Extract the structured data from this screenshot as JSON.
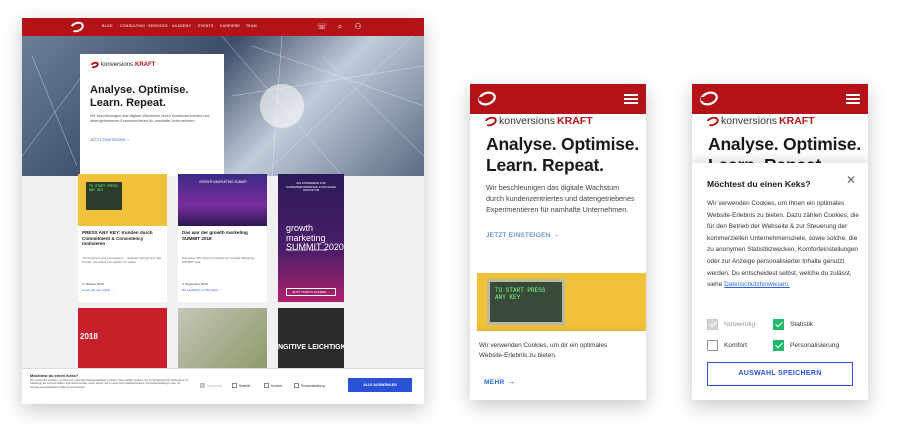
{
  "desktop": {
    "nav": {
      "items": [
        "BLOG",
        "CONSULTING",
        "SERVICES",
        "ACADEMY",
        "EVENTS",
        "KARRIERE",
        "TEAM",
        "ÜBER UNS"
      ]
    },
    "logo": {
      "prefix": "konversions",
      "suffix": "KRAFT"
    },
    "hero": {
      "title": "Analyse. Optimise. Learn. Repeat.",
      "subtitle": "Wir beschleunigen das digitale Wachstum durch kundenzentriertes und datengetriebenes Experimentieren für namhafte Unternehmen.",
      "cta": "JETZT EINSTEIGEN →"
    },
    "cards": [
      {
        "img_text": "TO START PRESS ANY KEY",
        "title": "PRESS ANY KEY: Kunden durch Commitment & Consistency motivieren",
        "excerpt": "\"Commitment und Consistency\" – dahinter verbirgt sich das Prinzip, uns selbst treu bleiben zu wollen.",
        "date": "4. Oktober 2018",
        "link": "Lesen Sie den Artikel →"
      },
      {
        "img_text": "GROWTH MARKETING SUMMIT",
        "title": "Das war der growth marketing SUMMIT 2018",
        "excerpt": "Wie jedes Jahr fand in Frankfurt der Growth Marketing SUMMIT statt.",
        "date": "4. September 2018",
        "link": "Die Highlights im Überblick →"
      }
    ],
    "summit": {
      "top": "DIE KONFERENZ FÜR KUNDENZENTRIERUNG & DIGITALES WACHSTUM",
      "title": "growth marketing SUMMIT 2020",
      "meta": "September 2020 · Frankfurt/Main",
      "btn": "JETZT TICKETS SICHERN →"
    },
    "row2": {
      "year": "2018",
      "banner": "NGITIVE LEICHTIGKE"
    },
    "cookie": {
      "heading": "Möchtest du einen Keks?",
      "text": "Wir verwenden Cookies, um Ihnen ein optimales Website-Erlebnis zu bieten. Dazu zählen Cookies, die für den Betrieb der Webseite & zur Steuerung der kommerziellen Unternehmensziele, sowie solche, die zu anonymen Statistikzwecken, Komforteinstellungen oder zur Anzeige personalisierter Inhalte genutzt werden.",
      "options": [
        "Notwendig",
        "Statistik",
        "Komfort",
        "Personalisierung"
      ],
      "button": "ALLE AUSWÄHLEN"
    }
  },
  "mobile1": {
    "logo": {
      "prefix": "konversions",
      "suffix": "KRAFT"
    },
    "title": "Analyse. Optimise. Learn. Repeat.",
    "text": "Wir beschleunigen das digitale Wachstum durch kundenzentriertes und datengetriebenes Experimentieren für namhafte Unternehmen.",
    "cta": "JETZT EINSTEIGEN",
    "img_text": "TO START PRESS ANY KEY",
    "cookie_text": "Wir verwenden Cookies, um dir ein optimales Website-Erlebnis zu bieten.",
    "more": "MEHR"
  },
  "mobile2": {
    "logo": {
      "prefix": "konversions",
      "suffix": "KRAFT"
    },
    "title": "Analyse. Optimise.",
    "title2": "Learn. Repeat.",
    "modal_title": "Möchtest du einen Keks?",
    "modal_text": "Wir verwenden Cookies, um Ihnen ein optimales Website-Erlebnis zu bieten. Dazu zählen Cookies, die für den Betrieb der Webseite & zur Steuerung der kommerziellen Unternehmensziele, sowie solche, die zu anonymen Statistikzwecken, Komforteinstellungen oder zur Anzeige personalisierter Inhalte genutzt werden. Du entscheidest selbst, welche du zulässt, siehe",
    "modal_link": "Datenschutzhinweisen.",
    "options": [
      {
        "label": "Notwendig",
        "state": "disabled"
      },
      {
        "label": "Statistik",
        "state": "checked"
      },
      {
        "label": "Komfort",
        "state": "unchecked"
      },
      {
        "label": "Personalisierung",
        "state": "checked"
      }
    ],
    "save": "AUSWAHL SPEICHERN"
  },
  "colors": {
    "brand": "#b31317",
    "link": "#2a6bd3",
    "button": "#2a52d8",
    "check": "#1fb86a"
  }
}
